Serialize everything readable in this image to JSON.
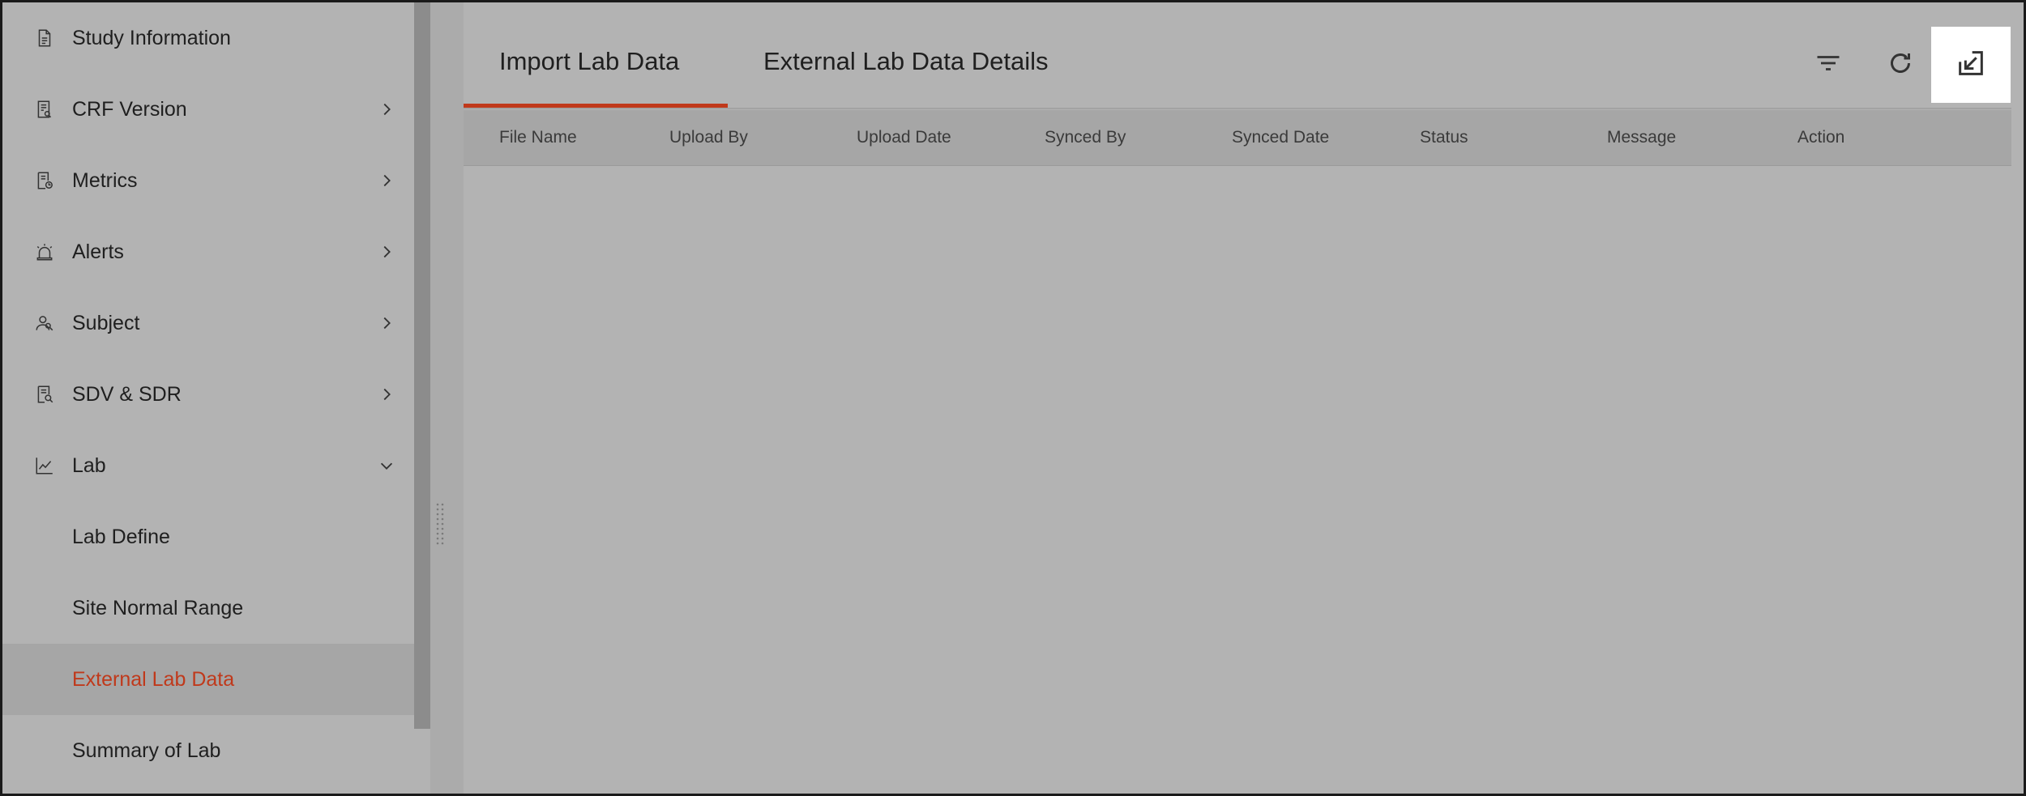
{
  "sidebar": {
    "items": [
      {
        "label": "Study Information",
        "icon": "document-icon",
        "has_chevron": false
      },
      {
        "label": "CRF Version",
        "icon": "form-version-icon",
        "has_chevron": true
      },
      {
        "label": "Metrics",
        "icon": "metrics-icon",
        "has_chevron": true
      },
      {
        "label": "Alerts",
        "icon": "alarm-icon",
        "has_chevron": true
      },
      {
        "label": "Subject",
        "icon": "users-icon",
        "has_chevron": true
      },
      {
        "label": "SDV & SDR",
        "icon": "doc-search-icon",
        "has_chevron": true
      },
      {
        "label": "Lab",
        "icon": "line-chart-icon",
        "has_chevron": true,
        "expanded": true
      }
    ],
    "sub_items": [
      {
        "label": "Lab Define"
      },
      {
        "label": "Site Normal Range"
      },
      {
        "label": "External Lab Data",
        "active": true
      },
      {
        "label": "Summary of Lab"
      }
    ]
  },
  "main": {
    "tabs": [
      {
        "label": "Import Lab Data",
        "active": true
      },
      {
        "label": "External Lab Data Details",
        "active": false
      }
    ],
    "toolbar": {
      "filter_icon": "filter-icon",
      "refresh_icon": "refresh-icon",
      "import_icon": "import-icon"
    },
    "table": {
      "columns": [
        "File Name",
        "Upload By",
        "Upload Date",
        "Synced By",
        "Synced Date",
        "Status",
        "Message",
        "Action"
      ],
      "rows": []
    }
  },
  "colors": {
    "accent": "#c0391b",
    "overlay_bg": "#b3b3b3",
    "header_bg": "#a6a6a6"
  }
}
